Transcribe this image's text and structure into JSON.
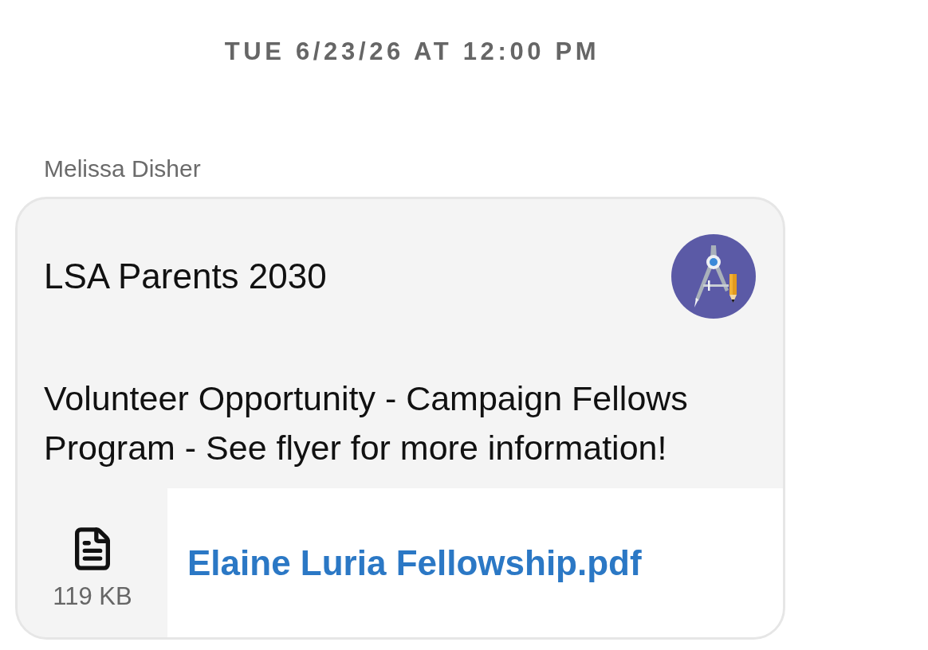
{
  "timestamp": "TUE 6/23/26 AT 12:00 PM",
  "message": {
    "sender": "Melissa Disher",
    "group": "LSA Parents 2030",
    "body": "Volunteer Opportunity - Campaign Fellows Program - See flyer for more information!",
    "attachment": {
      "size": "119 KB",
      "filename": "Elaine Luria Fellowship.pdf"
    }
  }
}
